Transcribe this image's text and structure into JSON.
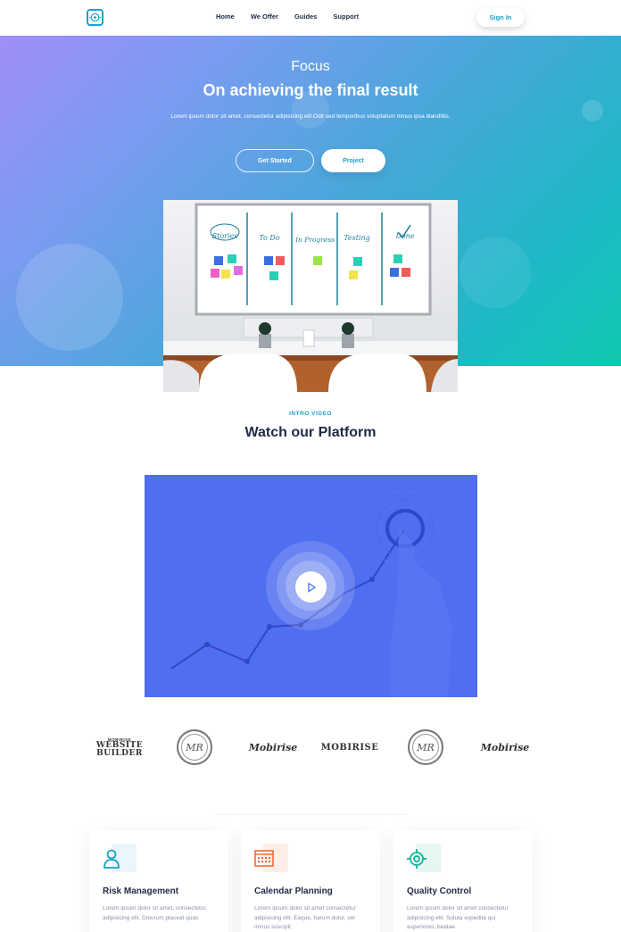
{
  "nav": {
    "logo_icon": "target-logo-icon",
    "links": [
      "Home",
      "We Offer",
      "Guides",
      "Support"
    ],
    "signin_label": "Sign In"
  },
  "hero": {
    "kicker": "Focus",
    "title": "On achieving the final result",
    "subtitle": "Lorem ipsum dolor sit amet, consectetur adipisicing elit.Odit sed temporibus voluptatum minus ipsa blanditiis.",
    "primary_button": "Get Started",
    "secondary_button": "Project",
    "gradient": [
      "#a08ef5",
      "#45a8d8",
      "#10c9b0"
    ]
  },
  "board": {
    "columns": [
      "Stories",
      "To Do",
      "In Progress",
      "Testing",
      "Done"
    ]
  },
  "intro": {
    "label": "INTRO VIDEO",
    "title": "Watch our Platform",
    "video_color": "#4f6ef0",
    "play_icon": "play-icon"
  },
  "logos": {
    "items": [
      {
        "kind": "block",
        "text": "WEBSITE BUILDER",
        "top": "MOBIRISE"
      },
      {
        "kind": "seal",
        "text": "MR"
      },
      {
        "kind": "script",
        "text": "Mobirise"
      },
      {
        "kind": "block",
        "text": "MOBIRISE"
      },
      {
        "kind": "seal",
        "text": "MR"
      },
      {
        "kind": "script",
        "text": "Mobirise"
      }
    ]
  },
  "cards": [
    {
      "icon": "user-icon",
      "accent": "#1aa3c9",
      "tint": "#eaf6fb",
      "title": "Risk Management",
      "text": "Lorem ipsum dolor sit amet, consectetur, adipisicing elit. Dolorum placeat quas"
    },
    {
      "icon": "calendar-icon",
      "accent": "#f06a3b",
      "tint": "#fdeee8",
      "title": "Calendar Planning",
      "text": "Lorem ipsum dolor sit amet consectetur adipisicing elit. Eaque, harum dolor, vel minus suscipit"
    },
    {
      "icon": "target-icon",
      "accent": "#16b39a",
      "tint": "#e6f7f3",
      "title": "Quality Control",
      "text": "Lorem ipsum dolor sit amet consectetur adipisicing elit. Soluta expedita qui asperiores, beatae"
    }
  ]
}
